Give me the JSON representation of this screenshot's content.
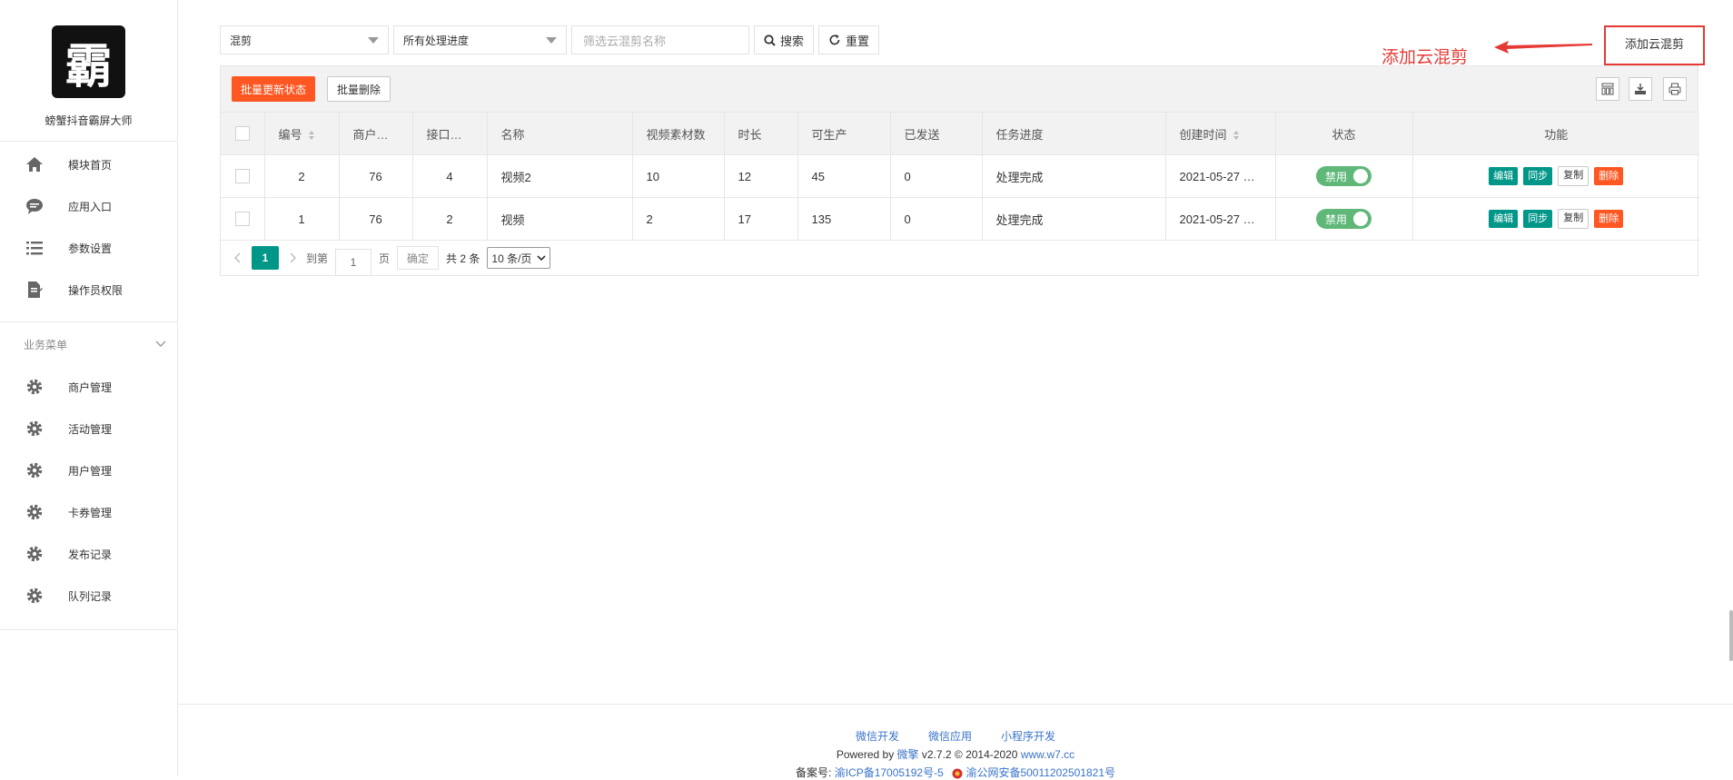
{
  "sidebar": {
    "logo_char": "霸",
    "brand": "螃蟹抖音霸屏大师",
    "top_items": [
      {
        "label": "模块首页",
        "icon": "home-icon"
      },
      {
        "label": "应用入口",
        "icon": "chat-icon"
      },
      {
        "label": "参数设置",
        "icon": "list-icon"
      },
      {
        "label": "操作员权限",
        "icon": "document-edit-icon"
      }
    ],
    "group_label": "业务菜单",
    "biz_items": [
      {
        "label": "商户管理",
        "icon": "gear-icon"
      },
      {
        "label": "活动管理",
        "icon": "gear-icon"
      },
      {
        "label": "用户管理",
        "icon": "gear-icon"
      },
      {
        "label": "卡券管理",
        "icon": "gear-icon"
      },
      {
        "label": "发布记录",
        "icon": "gear-icon"
      },
      {
        "label": "队列记录",
        "icon": "gear-icon"
      }
    ]
  },
  "filters": {
    "type_value": "混剪",
    "progress_value": "所有处理进度",
    "name_placeholder": "筛选云混剪名称",
    "search_label": "搜索",
    "reset_label": "重置"
  },
  "add_button_label": "添加云混剪",
  "annotation_text": "添加云混剪",
  "table_toolbar": {
    "batch_update_label": "批量更新状态",
    "batch_delete_label": "批量删除"
  },
  "columns": [
    "编号",
    "商户…",
    "接口…",
    "名称",
    "视频素材数",
    "时长",
    "可生产",
    "已发送",
    "任务进度",
    "创建时间",
    "状态",
    "功能"
  ],
  "rows": [
    {
      "id": "2",
      "merchant": "76",
      "api": "4",
      "name": "视频2",
      "materials": "10",
      "duration": "12",
      "producible": "45",
      "sent": "0",
      "progress": "处理完成",
      "created": "2021-05-27 …",
      "status": "禁用"
    },
    {
      "id": "1",
      "merchant": "76",
      "api": "2",
      "name": "视频",
      "materials": "2",
      "duration": "17",
      "producible": "135",
      "sent": "0",
      "progress": "处理完成",
      "created": "2021-05-27 …",
      "status": "禁用"
    }
  ],
  "actions": {
    "edit": "编辑",
    "sync": "同步",
    "copy": "复制",
    "delete": "删除"
  },
  "pagination": {
    "current_page": "1",
    "goto_label": "到第",
    "goto_value": "1",
    "page_suffix": "页",
    "confirm_label": "确定",
    "total_text": "共 2 条",
    "page_size": "10 条/页"
  },
  "footer": {
    "links": [
      "微信开发",
      "微信应用",
      "小程序开发"
    ],
    "powered_prefix": "Powered by ",
    "powered_brand": "微擎",
    "powered_version": " v2.7.2 © 2014-2020 ",
    "powered_site": "www.w7.cc",
    "icp_label": "备案号:",
    "icp_number": "渝ICP备17005192号-5",
    "police_number": "渝公网安备50011202501821号"
  },
  "colors": {
    "accent": "#009688",
    "danger": "#ff5722",
    "annotation": "#e53935",
    "switch": "#5fb878"
  }
}
